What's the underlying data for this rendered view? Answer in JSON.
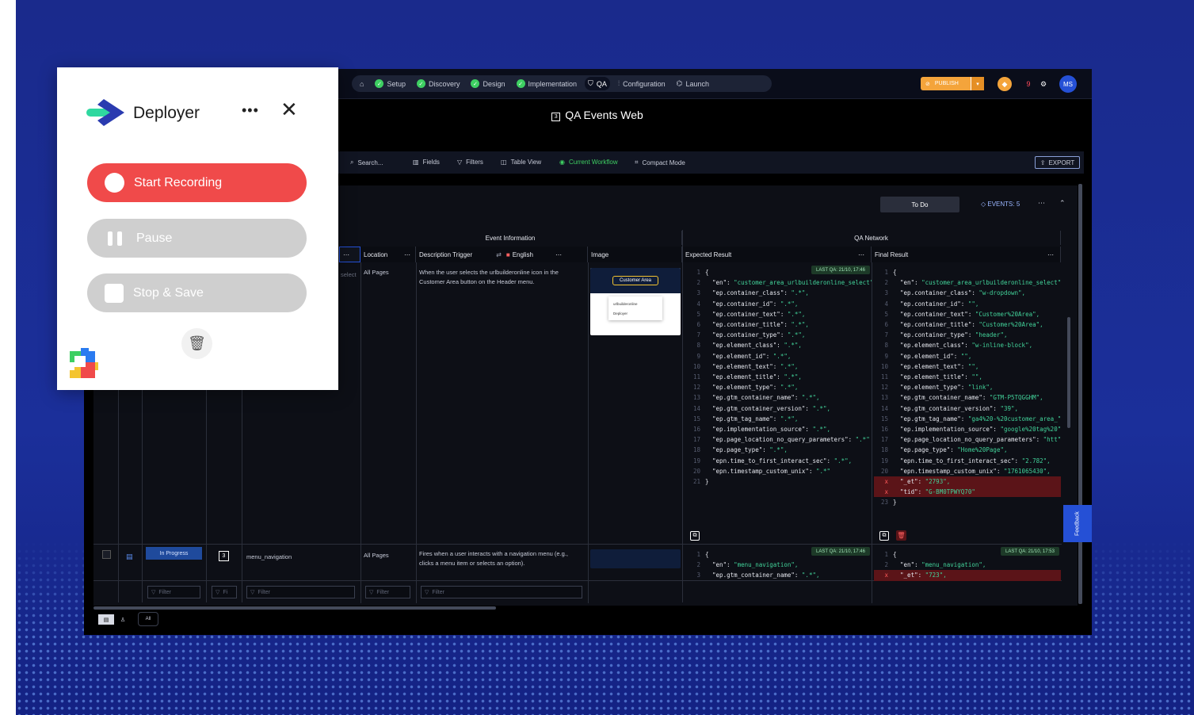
{
  "extension": {
    "brand": "Deployer",
    "buttons": {
      "start": "Start Recording",
      "pause": "Pause",
      "stop": "Stop & Save"
    },
    "colors": {
      "start": "#f04a4a",
      "disabled": "#cfcfcf"
    }
  },
  "nav": {
    "steps": [
      {
        "label": "Setup",
        "done": true
      },
      {
        "label": "Discovery",
        "done": true
      },
      {
        "label": "Design",
        "done": true
      },
      {
        "label": "Implementation",
        "done": true
      },
      {
        "label": "QA",
        "active": true
      },
      {
        "label": "Configuration"
      },
      {
        "label": "Launch"
      }
    ],
    "publish": "PUBLISH",
    "notification_count": "9",
    "avatar": "MS"
  },
  "page": {
    "title": "QA Events Web"
  },
  "toolbar": {
    "search_placeholder": "Search...",
    "fields": "Fields",
    "filters": "Filters",
    "table_view": "Table View",
    "current_workflow": "Current Workflow",
    "compact_mode": "Compact Mode",
    "export": "EXPORT"
  },
  "group": {
    "status": "To Do",
    "events": "EVENTS: 5"
  },
  "table": {
    "group_headers": {
      "event_info": "Event Information",
      "qa_network": "QA Network"
    },
    "columns": {
      "location": "Location",
      "description": "Description Trigger",
      "language": "English",
      "image": "Image",
      "expected": "Expected Result",
      "final": "Final Result"
    },
    "row1": {
      "select_fragment": "select",
      "location": "All Pages",
      "description": "When the user selects the urlbuilderonline icon in the Customer Area button on the Header menu.",
      "image_label": "Customer Area",
      "image_site": "urlbuilderonline",
      "image_brand": "Deployer",
      "expected_badge": "LAST QA: 21/10, 17:46",
      "expected": [
        [
          "{",
          ""
        ],
        [
          "\"en\": ",
          "\"customer_area_urlbuilderonline_select\""
        ],
        [
          "\"ep.container_class\": ",
          "\".*\","
        ],
        [
          "\"ep.container_id\": ",
          "\".*\","
        ],
        [
          "\"ep.container_text\": ",
          "\".*\","
        ],
        [
          "\"ep.container_title\": ",
          "\".*\","
        ],
        [
          "\"ep.container_type\": ",
          "\".*\","
        ],
        [
          "\"ep.element_class\": ",
          "\".*\","
        ],
        [
          "\"ep.element_id\": ",
          "\".*\","
        ],
        [
          "\"ep.element_text\": ",
          "\".*\","
        ],
        [
          "\"ep.element_title\": ",
          "\".*\","
        ],
        [
          "\"ep.element_type\": ",
          "\".*\","
        ],
        [
          "\"ep.gtm_container_name\": ",
          "\".*\","
        ],
        [
          "\"ep.gtm_container_version\": ",
          "\".*\","
        ],
        [
          "\"ep.gtm_tag_name\": ",
          "\".*\","
        ],
        [
          "\"ep.implementation_source\": ",
          "\".*\","
        ],
        [
          "\"ep.page_location_no_query_parameters\": ",
          "\".*\""
        ],
        [
          "\"ep.page_type\": ",
          "\".*\","
        ],
        [
          "\"epn.time_to_first_interact_sec\": ",
          "\".*\","
        ],
        [
          "\"epn.timestamp_custom_unix\": ",
          "\".*\""
        ],
        [
          "}",
          ""
        ]
      ],
      "final": [
        [
          "{",
          "",
          ""
        ],
        [
          "\"en\": ",
          "\"customer_area_urlbuilderonline_select\"",
          ""
        ],
        [
          "\"ep.container_class\": ",
          "\"w-dropdown\",",
          ""
        ],
        [
          "\"ep.container_id\": ",
          "\"\",",
          ""
        ],
        [
          "\"ep.container_text\": ",
          "\"Customer%20Area\",",
          ""
        ],
        [
          "\"ep.container_title\": ",
          "\"Customer%20Area\",",
          ""
        ],
        [
          "\"ep.container_type\": ",
          "\"header\",",
          ""
        ],
        [
          "\"ep.element_class\": ",
          "\"w-inline-block\",",
          ""
        ],
        [
          "\"ep.element_id\": ",
          "\"\",",
          ""
        ],
        [
          "\"ep.element_text\": ",
          "\"\",",
          ""
        ],
        [
          "\"ep.element_title\": ",
          "\"\",",
          ""
        ],
        [
          "\"ep.element_type\": ",
          "\"link\",",
          ""
        ],
        [
          "\"ep.gtm_container_name\": ",
          "\"GTM-P5TQGGHM\",",
          ""
        ],
        [
          "\"ep.gtm_container_version\": ",
          "\"39\",",
          ""
        ],
        [
          "\"ep.gtm_tag_name\": ",
          "\"ga4%20-%20customer_area_\"",
          ""
        ],
        [
          "\"ep.implementation_source\": ",
          "\"google%20tag%20\"",
          ""
        ],
        [
          "\"ep.page_location_no_query_parameters\": ",
          "\"htt\"",
          ""
        ],
        [
          "\"ep.page_type\": ",
          "\"Home%20Page\",",
          ""
        ],
        [
          "\"epn.time_to_first_interact_sec\": ",
          "\"2.782\",",
          ""
        ],
        [
          "\"epn.timestamp_custom_unix\": ",
          "\"1761065430\",",
          ""
        ],
        [
          "\"_et\": ",
          "\"2793\",",
          "err"
        ],
        [
          "\"tid\": ",
          "\"G-BM0TPWYQ70\"",
          "err"
        ],
        [
          "}",
          "",
          ""
        ]
      ]
    },
    "row2": {
      "status": "In Progress",
      "name": "menu_navigation",
      "location": "All Pages",
      "description": "Fires when a user interacts with a navigation menu (e.g., clicks a menu item or selects an option).",
      "expected_badge": "LAST QA: 21/10, 17:46",
      "expected": [
        [
          "{",
          ""
        ],
        [
          "\"en\": ",
          "\"menu_navigation\","
        ],
        [
          "\"ep.gtm_container_name\": ",
          "\".*\","
        ]
      ],
      "final_badge": "LAST QA: 21/10, 17:53",
      "final": [
        [
          "{",
          "",
          ""
        ],
        [
          "\"en\": ",
          "\"menu_navigation\",",
          ""
        ],
        [
          "\"_et\": ",
          "\"723\",",
          "err"
        ]
      ]
    },
    "filter_placeholder": "Filter",
    "filter_short": "Fi",
    "bottom_tab": "All"
  },
  "feedback": "Feedback"
}
